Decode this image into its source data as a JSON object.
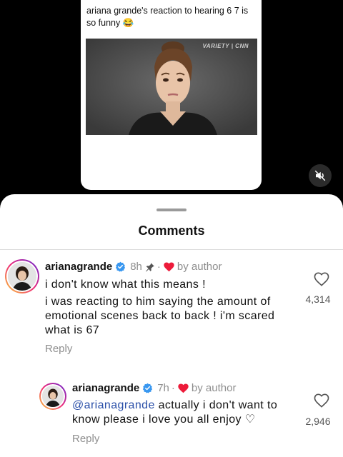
{
  "post": {
    "caption": "ariana grande's reaction to hearing 6 7 is so funny 😂",
    "logo_text": "VARIETY | CNN"
  },
  "sheet": {
    "title": "Comments"
  },
  "comments": [
    {
      "username": "arianagrande",
      "time": "8h",
      "by_author": "by author",
      "text_lines": [
        "i don't know what this means !",
        "i was reacting to him saying the amount of",
        "emotional scenes back to back ! i'm scared",
        "what is 67"
      ],
      "likes": "4,314",
      "reply_label": "Reply"
    },
    {
      "username": "arianagrande",
      "time": "7h",
      "by_author": "by author",
      "mention": "@arianagrande",
      "text_rest_line1": " actually i don't want to",
      "text_line2": "know please i love you all enjoy ♡",
      "likes": "2,946",
      "reply_label": "Reply"
    }
  ],
  "colors": {
    "verified": "#3897f0",
    "heart": "#ed1b3a",
    "mention": "#2a4fa8"
  }
}
